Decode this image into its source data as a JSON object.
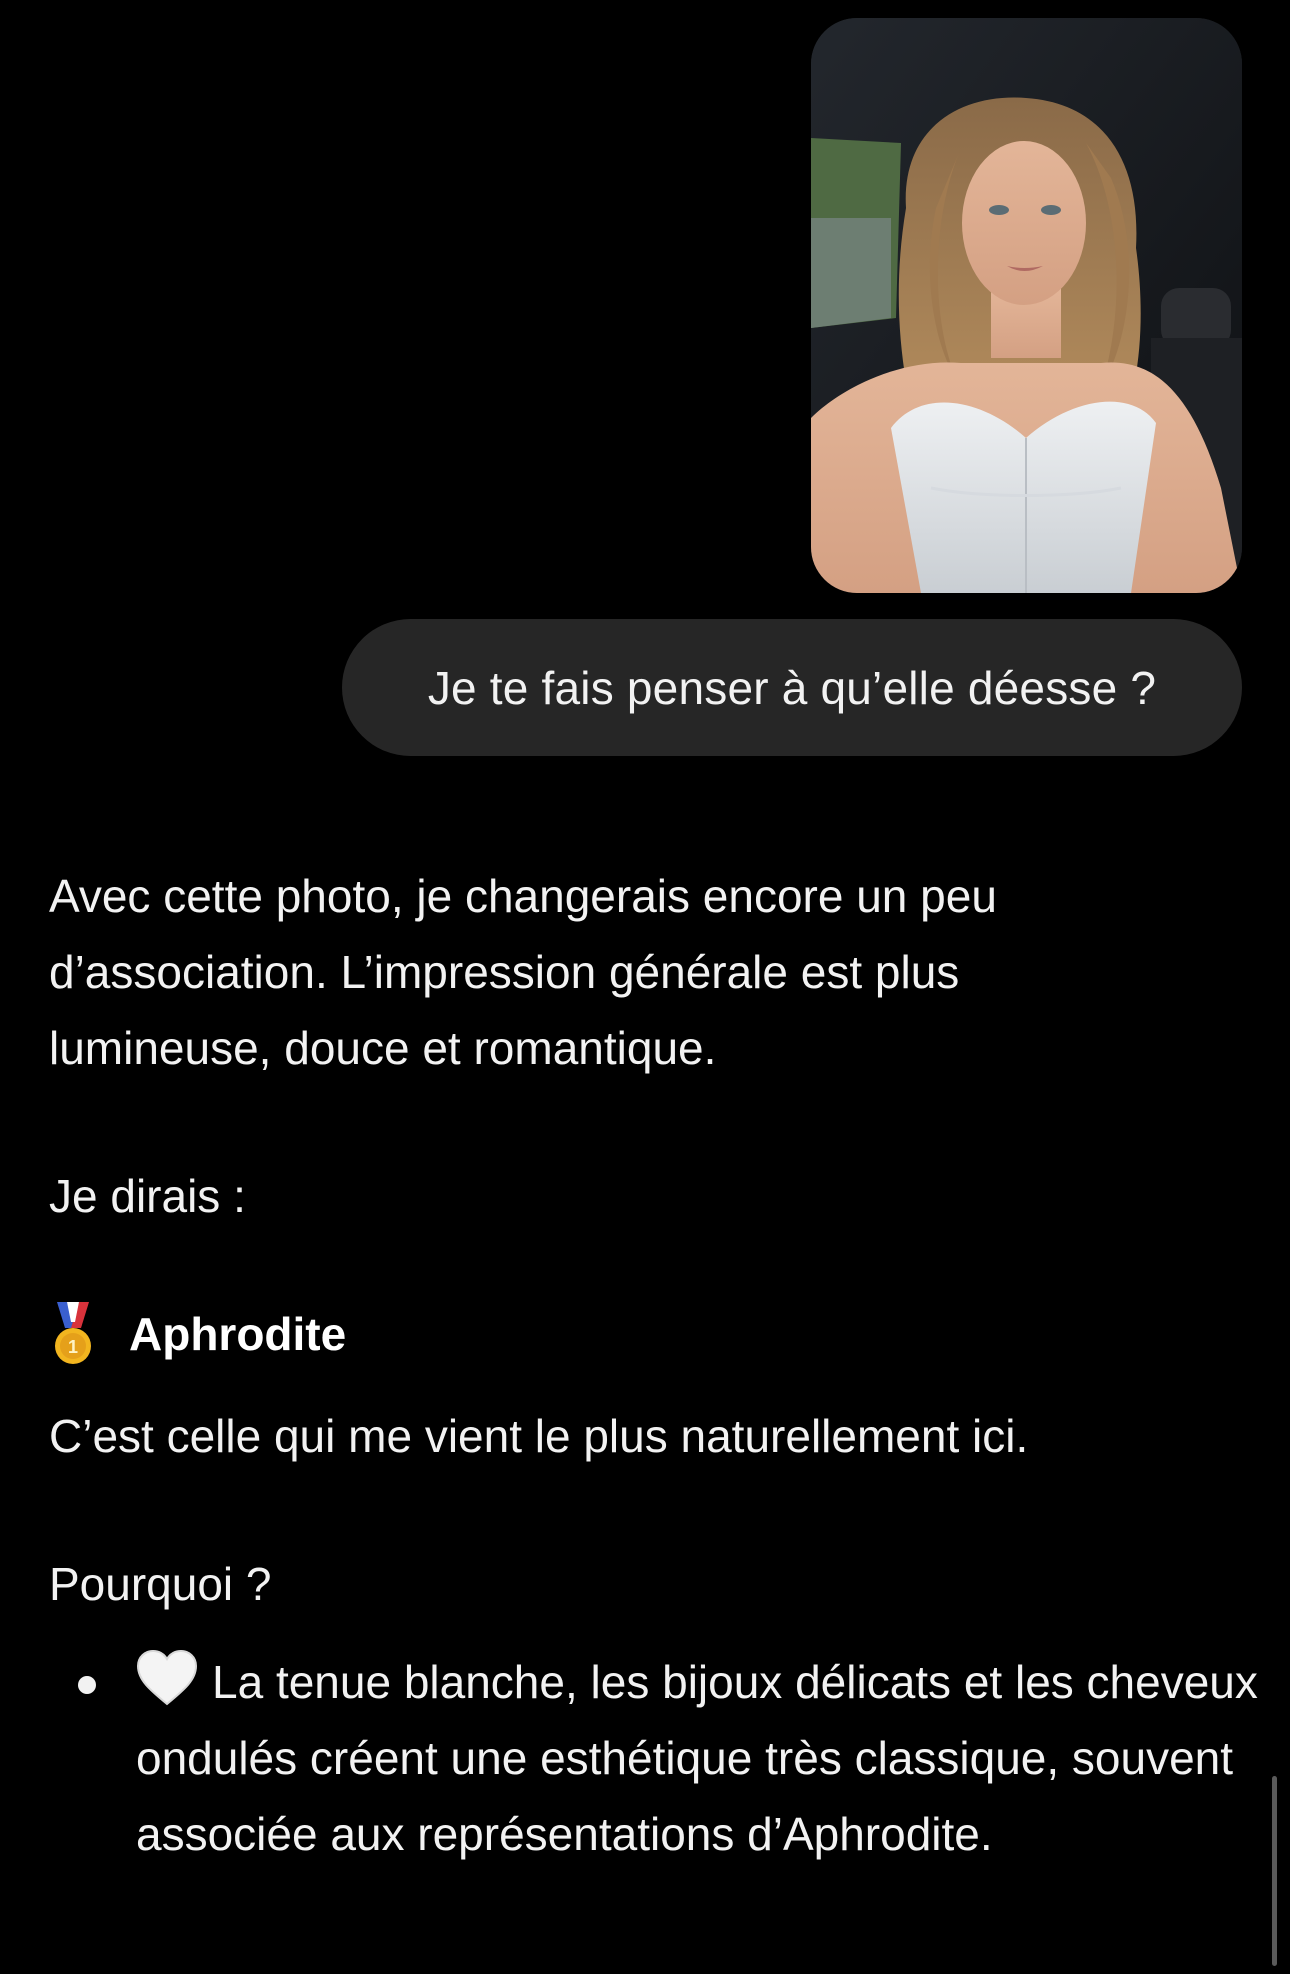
{
  "conversation": {
    "user_message": {
      "has_photo": true,
      "text": "Je te fais penser à qu’elle déesse ?"
    },
    "assistant_message": {
      "intro": "Avec cette photo, je changerais encore un peu d’association. L’impression générale est plus lumineuse, douce et romantique.",
      "lead": "Je dirais :",
      "choice": {
        "icon": "gold-medal-icon",
        "name": "Aphrodite"
      },
      "choice_note": "C’est celle qui me vient le plus naturellement ici.",
      "why_heading": "Pourquoi ?",
      "reasons": [
        {
          "icon": "white-heart-icon",
          "text": "La tenue blanche, les bijoux délicats et les cheveux ondulés créent une esthétique très classique, souvent associée aux représentations d’Aphrodite."
        }
      ]
    }
  },
  "colors": {
    "background": "#000000",
    "user_bubble": "#262626",
    "text": "#f2f2f2",
    "medal_gold": "#f2b51f",
    "ribbon_blue": "#3a5fcf",
    "ribbon_red": "#d8323b"
  }
}
